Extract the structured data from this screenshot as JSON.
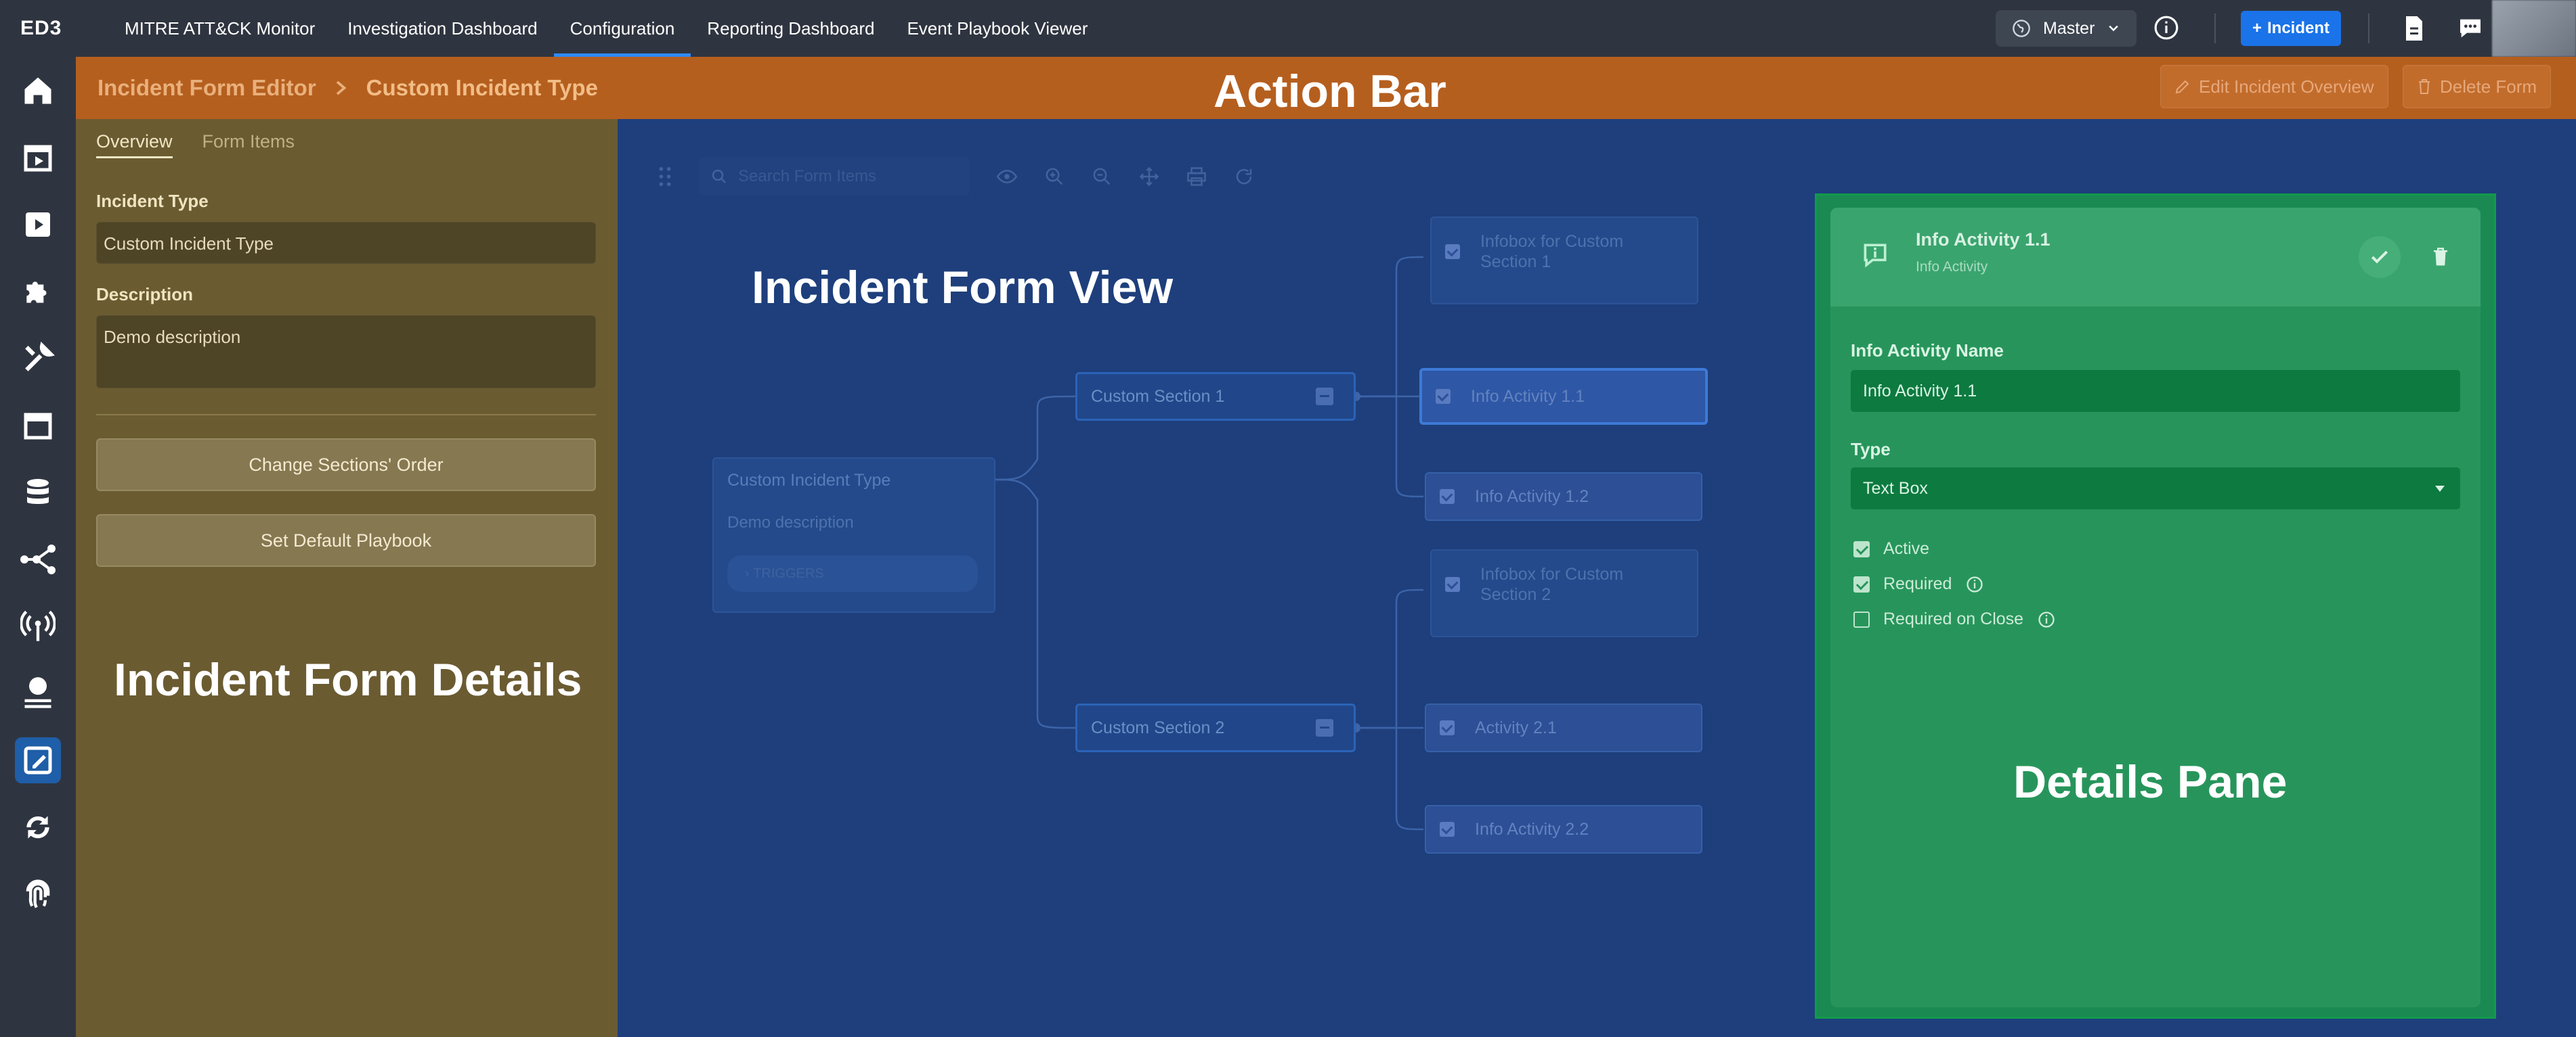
{
  "brand": {
    "logo": "ED3"
  },
  "nav": [
    {
      "label": "MITRE ATT&CK Monitor",
      "active": false
    },
    {
      "label": "Investigation Dashboard",
      "active": false
    },
    {
      "label": "Configuration",
      "active": true
    },
    {
      "label": "Reporting Dashboard",
      "active": false
    },
    {
      "label": "Event Playbook Viewer",
      "active": false
    }
  ],
  "topbar": {
    "master_label": "Master",
    "incident_button": "Incident"
  },
  "sidebar": {
    "icons": [
      "home-icon",
      "calendar-play-icon",
      "play-icon",
      "puzzle-icon",
      "tools-icon",
      "calendar-icon",
      "database-icon",
      "graph-icon",
      "antenna-icon",
      "globe-icon",
      "form-editor-icon",
      "sync-icon",
      "fingerprint-icon"
    ],
    "active_index": 10
  },
  "actionbar": {
    "crumb_parent": "Incident Form Editor",
    "crumb_current": "Custom Incident Type",
    "overlay_label": "Action Bar",
    "edit_button": "Edit Incident Overview",
    "delete_button": "Delete Form"
  },
  "left_panel": {
    "tabs": [
      {
        "label": "Overview",
        "active": true
      },
      {
        "label": "Form Items",
        "active": false
      }
    ],
    "incident_type_label": "Incident Type",
    "incident_type_value": "Custom Incident Type",
    "description_label": "Description",
    "description_value": "Demo description",
    "change_order_button": "Change Sections' Order",
    "default_playbook_button": "Set Default Playbook",
    "overlay_label": "Incident Form Details"
  },
  "canvas": {
    "search_placeholder": "Search Form Items",
    "overlay_label": "Incident Form View",
    "root": {
      "title": "Custom Incident Type",
      "description": "Demo description",
      "triggers": "TRIGGERS"
    },
    "sections": [
      "Custom Section 1",
      "Custom Section 2"
    ],
    "items": [
      "Infobox for Custom Section 1",
      "Info Activity 1.1",
      "Info Activity 1.2",
      "Infobox for Custom Section 2",
      "Activity 2.1",
      "Info Activity 2.2"
    ]
  },
  "details": {
    "name": "Info Activity 1.1",
    "subtitle": "Info Activity",
    "name_label": "Info Activity Name",
    "name_value": "Info Activity 1.1",
    "type_label": "Type",
    "type_value": "Text Box",
    "checkboxes": [
      {
        "label": "Active",
        "checked": true
      },
      {
        "label": "Required",
        "checked": true
      },
      {
        "label": "Required on Close",
        "checked": false
      }
    ],
    "overlay_label": "Details Pane"
  },
  "colors": {
    "action_bar": "#b55f1f",
    "left_panel": "#6b5b31",
    "canvas": "#1e3f7c",
    "details_pane": "#1a8a52",
    "topbar": "#2f3540",
    "accent": "#1a73e8"
  }
}
